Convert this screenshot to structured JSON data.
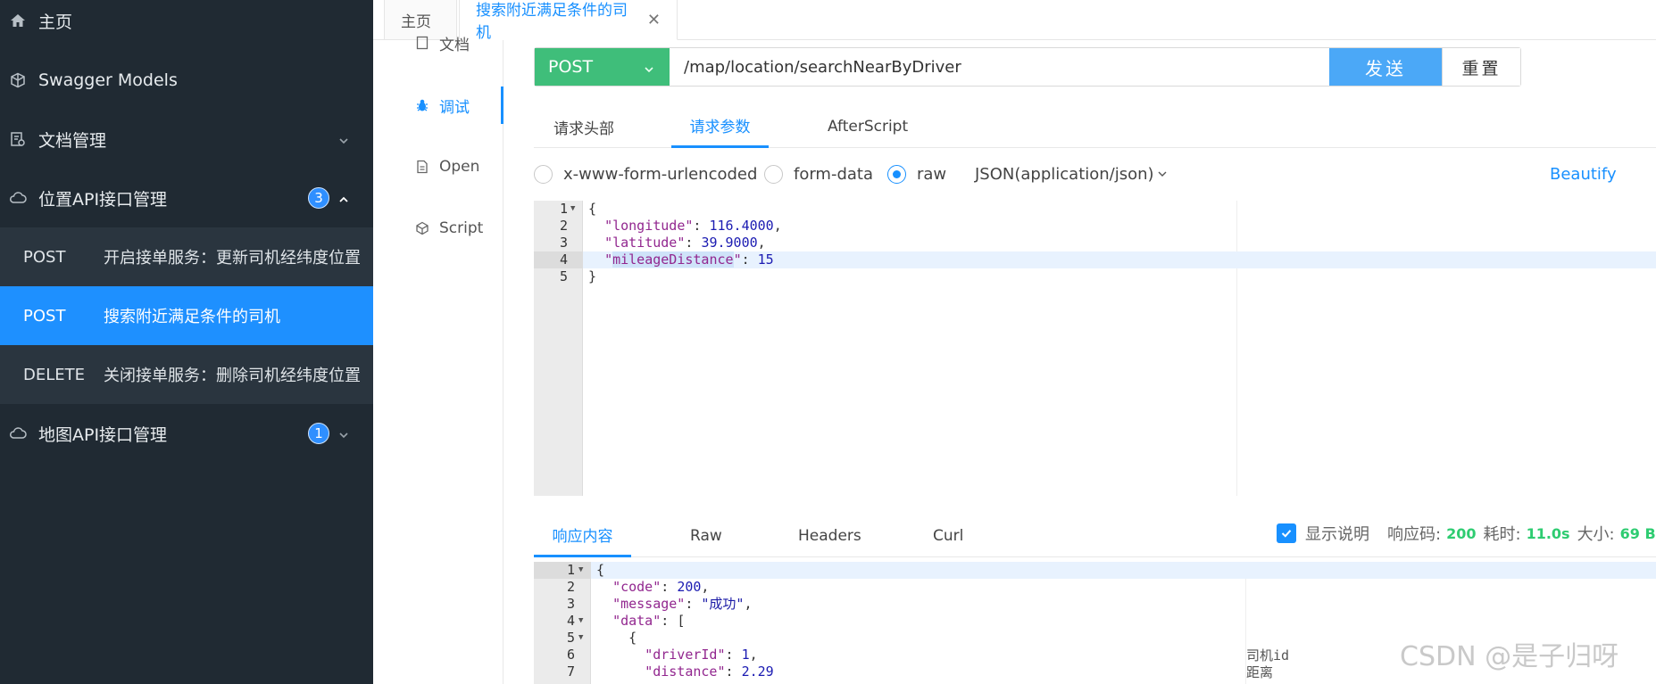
{
  "sidebar": {
    "home": "主页",
    "swagger_models": "Swagger Models",
    "doc_manage": "文档管理",
    "location_api": "位置API接口管理",
    "location_api_count": "3",
    "sub_items": [
      {
        "method": "POST",
        "name": "开启接单服务：更新司机经纬度位置"
      },
      {
        "method": "POST",
        "name": "搜索附近满足条件的司机"
      },
      {
        "method": "DELETE",
        "name": "关闭接单服务：删除司机经纬度位置"
      }
    ],
    "map_api": "地图API接口管理",
    "map_api_count": "1"
  },
  "tabs": {
    "home": "主页",
    "current": "搜索附近满足条件的司机",
    "close": "✕"
  },
  "subnav": {
    "doc": "文档",
    "debug": "调试",
    "open": "Open",
    "script": "Script"
  },
  "request": {
    "method": "POST",
    "url": "/map/location/searchNearByDriver",
    "send": "发送",
    "reset": "重置"
  },
  "param_tabs": [
    "请求头部",
    "请求参数",
    "AfterScript"
  ],
  "body_types": [
    "x-www-form-urlencoded",
    "form-data",
    "raw"
  ],
  "content_type": "JSON(application/json)",
  "beautify": "Beautify",
  "request_body": {
    "line_numbers": [
      "1",
      "2",
      "3",
      "4",
      "5"
    ],
    "open": "{",
    "longitude_key": "\"longitude\"",
    "longitude_val": "116.4000",
    "latitude_key": "\"latitude\"",
    "latitude_val": "39.9000",
    "mileage_key": "mileageDistance",
    "mileage_val": "15",
    "close": "}"
  },
  "response_tabs": [
    "响应内容",
    "Raw",
    "Headers",
    "Curl"
  ],
  "response_meta": {
    "show_desc": "显示说明",
    "code_label": "响应码:",
    "code": "200",
    "time_label": "耗时:",
    "time": "11.0s",
    "size_label": "大小:",
    "size": "69 B"
  },
  "response_body": {
    "line_numbers": [
      "1",
      "2",
      "3",
      "4",
      "5",
      "6",
      "7"
    ],
    "open": "{",
    "code_key": "\"code\"",
    "code_val": "200",
    "message_key": "\"message\"",
    "message_val": "\"成功\"",
    "data_key": "\"data\"",
    "data_open": "[",
    "obj_open": "{",
    "driver_key": "\"driverId\"",
    "driver_val": "1",
    "distance_key": "\"distance\"",
    "distance_val": "2.29",
    "comment_driver": "司机id",
    "comment_distance": "距离"
  },
  "watermark": "CSDN @是子归呀"
}
